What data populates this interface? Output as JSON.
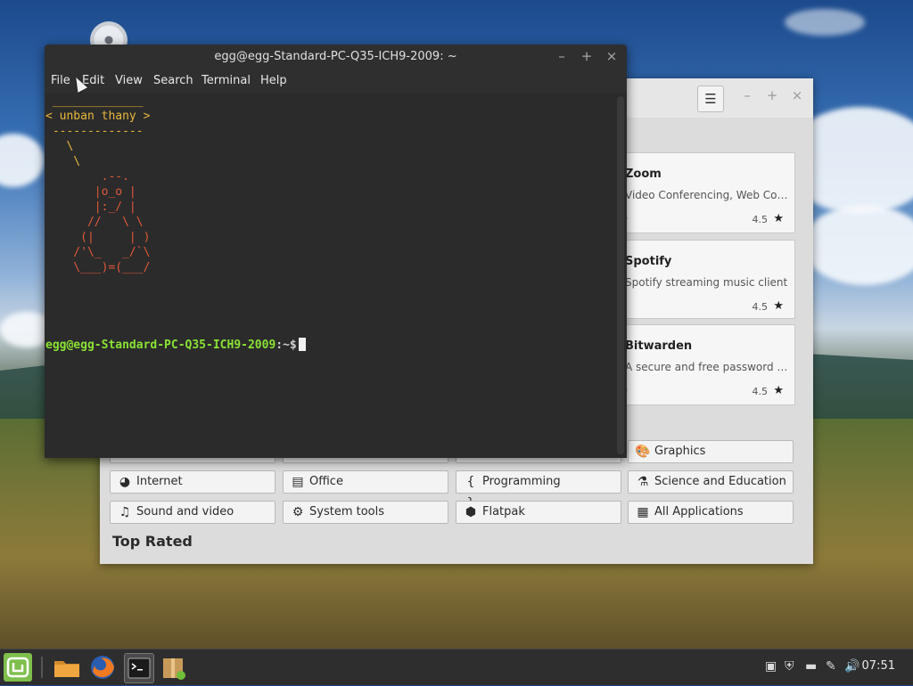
{
  "terminal": {
    "title": "egg@egg-Standard-PC-Q35-ICH9-2009: ~",
    "menu": [
      "File",
      "Edit",
      "View",
      "Search",
      "Terminal",
      "Help"
    ],
    "cowsay_top": " _____________",
    "cowsay_msg": "< unban thany >",
    "cowsay_bottom": " -------------",
    "tail_1": "   \\",
    "tail_2": "    \\",
    "tux_lines": [
      "        .--.",
      "       |o_o |",
      "       |:_/ |",
      "      //   \\ \\",
      "     (|     | )",
      "    /'\\_   _/`\\",
      "    \\___)=(___/"
    ],
    "prompt_user": "egg@egg-Standard-PC-Q35-ICH9-2009",
    "prompt_sep": ":",
    "prompt_path": "~$",
    "colors": {
      "user": "#8ae234",
      "cowsay": "#e9b73c",
      "tux": "#e0583a",
      "path": "#cfcfcf"
    }
  },
  "software_manager": {
    "cards": [
      {
        "title": "Zoom",
        "desc": "Video Conferencing, Web Conf…",
        "license": "b",
        "rating": "4.5"
      },
      {
        "title": "Spotify",
        "desc": "Spotify streaming music client",
        "license": "",
        "rating": "4.5"
      },
      {
        "title": "Bitwarden",
        "desc": "A secure and free password m…",
        "license": "b",
        "rating": "4.5"
      }
    ],
    "categories": [
      {
        "label": "Graphics",
        "icon": "palette-icon",
        "glyph": "🎨"
      },
      {
        "label": "Internet",
        "icon": "globe-icon",
        "glyph": "◕"
      },
      {
        "label": "Office",
        "icon": "presentation-icon",
        "glyph": "▤"
      },
      {
        "label": "Programming",
        "icon": "braces-icon",
        "glyph": "{ }"
      },
      {
        "label": "Science and Education",
        "icon": "flask-icon",
        "glyph": "⚗"
      },
      {
        "label": "Sound and video",
        "icon": "music-note-icon",
        "glyph": "♫"
      },
      {
        "label": "System tools",
        "icon": "gear-icon",
        "glyph": "⚙"
      },
      {
        "label": "Flatpak",
        "icon": "package-icon",
        "glyph": "⬢"
      },
      {
        "label": "All Applications",
        "icon": "grid-icon",
        "glyph": "▦"
      }
    ],
    "top_rated": "Top Rated",
    "menu_glyph": "☰"
  },
  "taskbar": {
    "clock": "07:51"
  }
}
